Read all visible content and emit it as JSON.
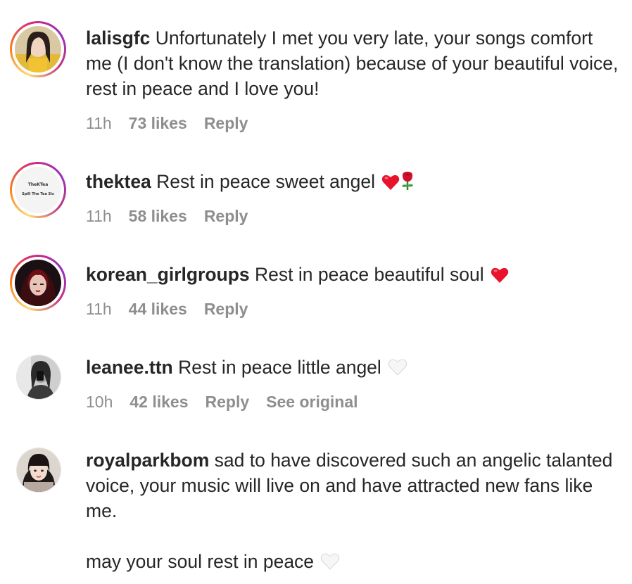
{
  "comments": [
    {
      "username": "lalisgfc",
      "text": "Unfortunately I met you very late, your songs comfort me (I don't know the translation) because of your beautiful voice, rest in peace and I love you!",
      "time": "11h",
      "likes": "73 likes",
      "reply": "Reply",
      "avatar_icon": "profile-photo-girl-yellow",
      "has_story_ring": true
    },
    {
      "username": "thektea",
      "text": "Rest in peace sweet angel",
      "emojis": [
        "red-heart-icon",
        "rose-icon"
      ],
      "time": "11h",
      "likes": "58 likes",
      "reply": "Reply",
      "avatar_logo_line1": "TheKTea",
      "avatar_logo_line2": "Spill The Tea Sis",
      "has_story_ring": true
    },
    {
      "username": "korean_girlgroups",
      "text": "Rest in peace beautiful soul",
      "emojis": [
        "red-heart-icon"
      ],
      "time": "11h",
      "likes": "44 likes",
      "reply": "Reply",
      "avatar_icon": "profile-photo-dark-red",
      "has_story_ring": true
    },
    {
      "username": "leanee.ttn",
      "text": "Rest in peace little angel",
      "emojis": [
        "white-heart-icon"
      ],
      "time": "10h",
      "likes": "42 likes",
      "reply": "Reply",
      "see_original": "See original",
      "avatar_icon": "profile-photo-bw-mirror",
      "has_story_ring": false
    },
    {
      "username": "royalparkbom",
      "text": "sad to have discovered such an angelic talanted voice, your music will live on and have attracted new fans like me.",
      "text2": "may your soul rest in peace",
      "emojis": [
        "white-heart-icon"
      ],
      "avatar_icon": "profile-photo-bangs",
      "has_story_ring": false
    }
  ],
  "colors": {
    "text": "#262626",
    "meta": "#8e8e8e",
    "ring_gradient": [
      "#feda75",
      "#fa7e1e",
      "#d62976",
      "#962fbf"
    ]
  }
}
